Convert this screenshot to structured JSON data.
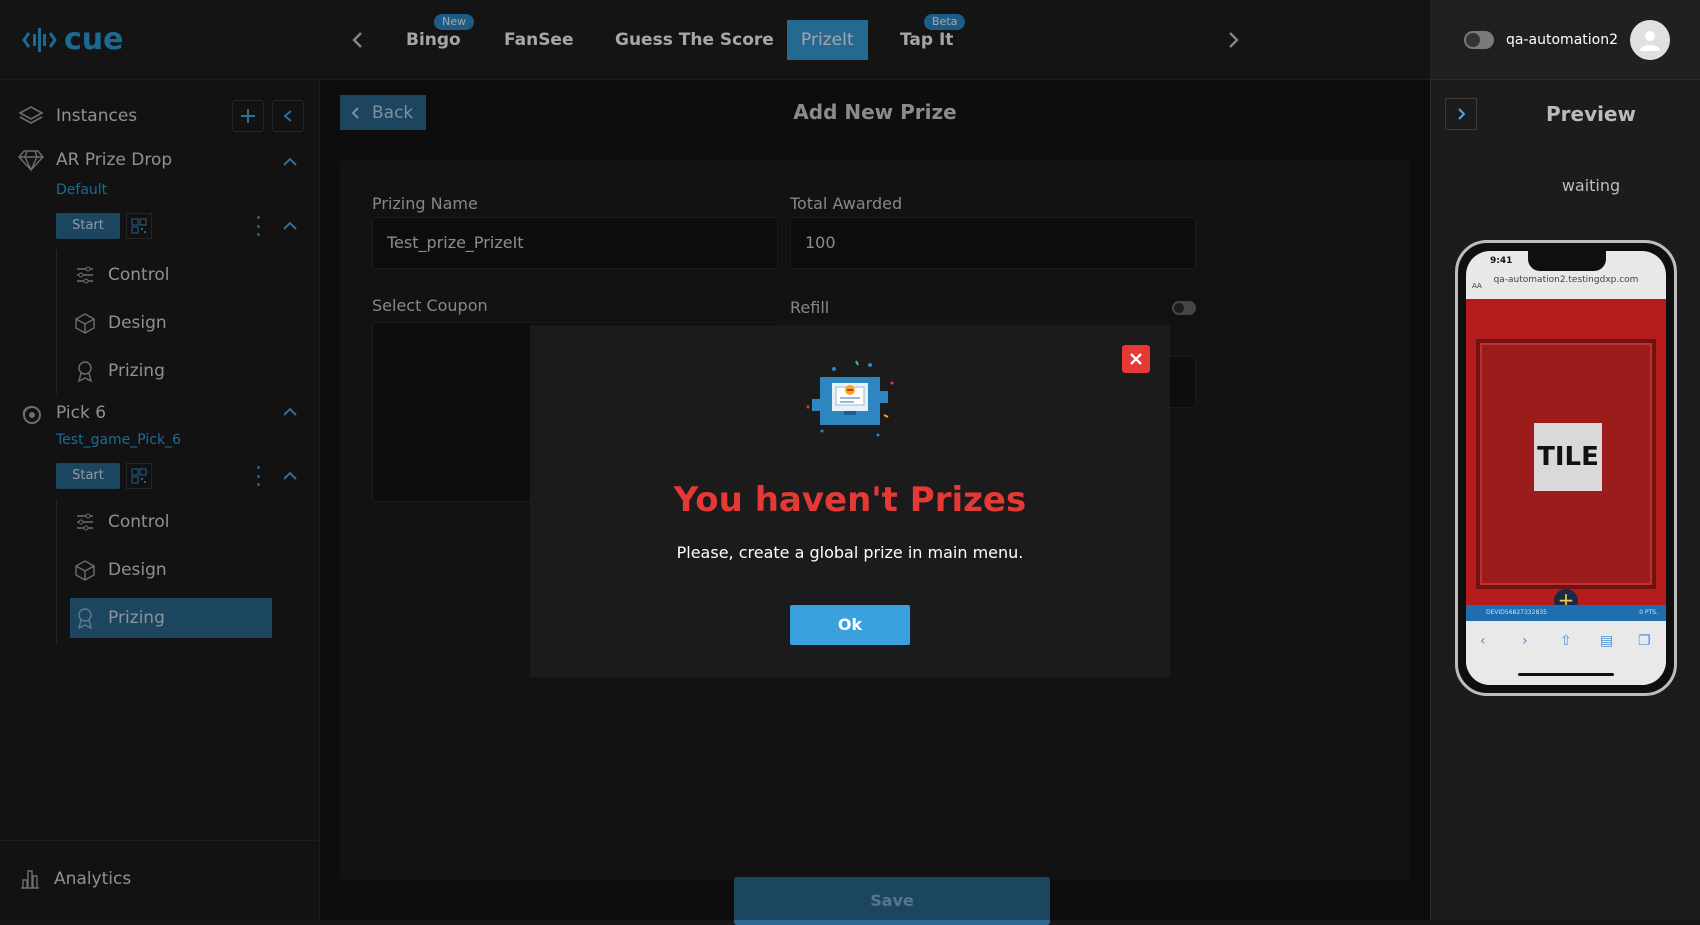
{
  "header": {
    "logo_text": "cue",
    "tabs": [
      {
        "label": "Bingo",
        "badge": "New"
      },
      {
        "label": "FanSee"
      },
      {
        "label": "Guess The Score"
      },
      {
        "label": "PrizeIt",
        "active": true
      },
      {
        "label": "Tap It",
        "badge": "Beta"
      }
    ],
    "username": "qa-automation2"
  },
  "sidebar": {
    "instances_label": "Instances",
    "games": [
      {
        "title": "AR Prize Drop",
        "instance": "Default",
        "start_label": "Start",
        "items": [
          "Control",
          "Design",
          "Prizing"
        ]
      },
      {
        "title": "Pick 6",
        "instance": "Test_game_Pick_6",
        "start_label": "Start",
        "items": [
          "Control",
          "Design",
          "Prizing"
        ]
      }
    ],
    "analytics_label": "Analytics"
  },
  "main": {
    "back_label": "Back",
    "title": "Add New Prize",
    "form": {
      "prizing_name_label": "Prizing Name",
      "prizing_name_value": "Test_prize_PrizeIt",
      "total_awarded_label": "Total Awarded",
      "total_awarded_value": "100",
      "select_coupon_label": "Select Coupon",
      "refill_label": "Refill"
    },
    "save_label": "Save"
  },
  "modal": {
    "title": "You haven't Prizes",
    "message": "Please, create a global prize in main menu.",
    "ok_label": "Ok"
  },
  "preview": {
    "title": "Preview",
    "status": "waiting",
    "phone": {
      "time": "9:41",
      "url": "qa-automation2.testingdxp.com",
      "tile_label": "TILE",
      "bar_left": "DEVID56827332835",
      "bar_right": "0 PTS."
    }
  },
  "colors": {
    "accent": "#3aa0de",
    "active_bg": "#2c6a94",
    "error": "#e53935"
  }
}
